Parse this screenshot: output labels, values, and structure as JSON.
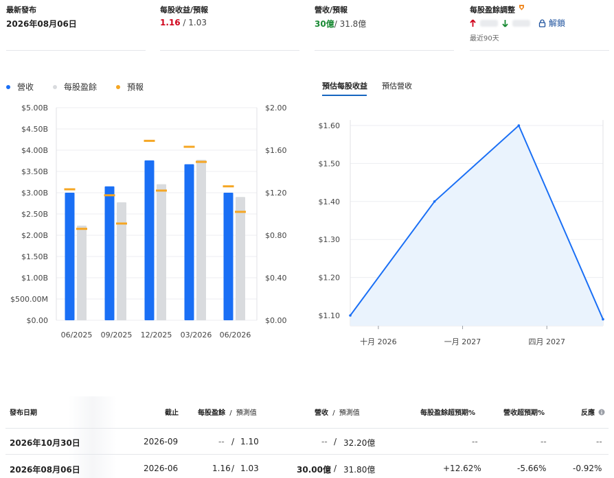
{
  "header": {
    "latest_release": {
      "label": "最新發布",
      "value": "2026年08月06日"
    },
    "eps": {
      "label": "每股收益/預報",
      "actual": "1.16",
      "sep": " / ",
      "forecast": "1.03"
    },
    "revenue": {
      "label": "營收/預報",
      "actual": "30億",
      "sep": "/ ",
      "forecast": "31.8億"
    },
    "eps_revision": {
      "label": "每股盈餘調整",
      "period": "最近90天",
      "unlock": "解鎖",
      "badge_icon": "premium-badge-icon"
    }
  },
  "legend": {
    "items": [
      {
        "label": "營收",
        "color": "#1a6ff5"
      },
      {
        "label": "每股盈餘",
        "color": "#d9dbde"
      },
      {
        "label": "預報",
        "color": "#f5a623"
      }
    ]
  },
  "tabs": [
    {
      "label": "預估每股收益",
      "active": true
    },
    {
      "label": "預估營收",
      "active": false
    }
  ],
  "chart_data": [
    {
      "type": "bar",
      "categories": [
        "06/2025",
        "09/2025",
        "12/2025",
        "03/2026",
        "06/2026"
      ],
      "left_axis": {
        "ticks": [
          "$5.00B",
          "$4.50B",
          "$4.00B",
          "$3.50B",
          "$3.00B",
          "$2.50B",
          "$2.00B",
          "$1.50B",
          "$1.00B",
          "$500.00M",
          "$0.00"
        ],
        "ylim": [
          0,
          5.0
        ]
      },
      "right_axis": {
        "ticks": [
          "$2.00",
          "$1.60",
          "$1.20",
          "$0.80",
          "$0.40",
          "$0.00"
        ],
        "ylim": [
          0,
          2.0
        ]
      },
      "series": [
        {
          "name": "營收",
          "axis": "left",
          "color": "#1a6ff5",
          "values": [
            3.0,
            3.15,
            3.76,
            3.67,
            3.0
          ]
        },
        {
          "name": "預報",
          "axis": "left",
          "color": "#f5a623",
          "values": [
            3.08,
            2.94,
            4.22,
            4.08,
            3.15
          ]
        },
        {
          "name": "每股盈餘",
          "axis": "right",
          "color": "#d9dbde",
          "values": [
            0.89,
            1.11,
            1.28,
            1.51,
            1.16
          ]
        },
        {
          "name": "預報",
          "axis": "right",
          "color": "#f5a623",
          "values": [
            0.86,
            0.91,
            1.22,
            1.49,
            1.02
          ]
        }
      ],
      "grid": true
    },
    {
      "type": "area",
      "x": [
        "2026-09",
        "2026-12",
        "2027-03",
        "2027-06"
      ],
      "values": [
        1.1,
        1.4,
        1.6,
        1.09
      ],
      "x_ticks": [
        "十月 2026",
        "一月 2027",
        "四月 2027"
      ],
      "y_ticks": [
        "$1.60",
        "$1.50",
        "$1.40",
        "$1.30",
        "$1.20",
        "$1.10"
      ],
      "ylim": [
        1.1,
        1.6
      ],
      "color": "#1a6ff5",
      "fill": "#eaf3fd",
      "grid": true
    }
  ],
  "table": {
    "headers": {
      "date": "發布日期",
      "period": "截止",
      "eps": "每股盈餘",
      "eps_sep": "/",
      "eps_fc": "預測值",
      "rev": "營收",
      "rev_sep": "/",
      "rev_fc": "預測值",
      "eps_surprise": "每股盈餘超預期%",
      "rev_surprise": "營收超預期%",
      "reaction": "反應"
    },
    "rows": [
      {
        "date": "2026年10月30日",
        "period": "2026-09",
        "eps": "--",
        "eps_fc": "1.10",
        "rev": "--",
        "rev_fc": "32.20億",
        "eps_surprise": "--",
        "rev_surprise": "--",
        "reaction": "--"
      },
      {
        "date": "2026年08月06日",
        "period": "2026-06",
        "eps": "1.16",
        "eps_fc": "1.03",
        "rev": "30.00億",
        "rev_fc": "31.80億",
        "eps_surprise": "+12.62%",
        "rev_surprise": "-5.66%",
        "reaction": "-0.92%"
      }
    ]
  }
}
